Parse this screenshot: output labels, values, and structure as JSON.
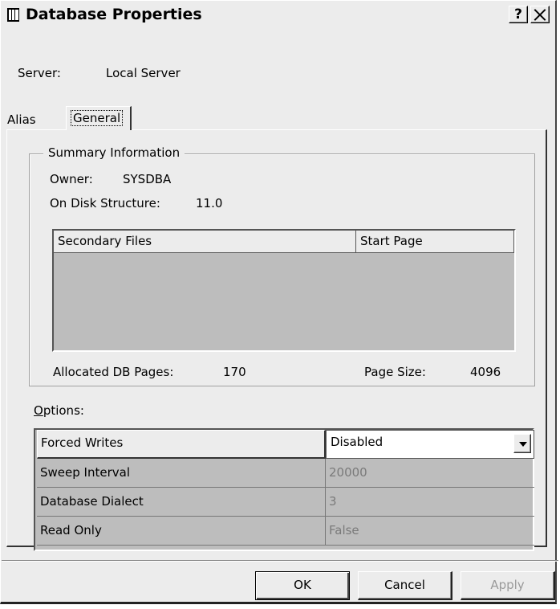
{
  "window": {
    "title": "Database Properties",
    "help_glyph": "?"
  },
  "server": {
    "label": "Server:",
    "value": "Local Server"
  },
  "tabs": [
    {
      "label": "Alias",
      "selected": false
    },
    {
      "label": "General",
      "selected": true
    }
  ],
  "summary": {
    "legend": "Summary Information",
    "owner_label": "Owner:",
    "owner_value": "SYSDBA",
    "ods_label": "On Disk Structure:",
    "ods_value": "11.0",
    "files_columns": [
      "Secondary Files",
      "Start Page"
    ],
    "files_rows": [],
    "allocated_label": "Allocated DB Pages:",
    "allocated_value": "170",
    "page_size_label": "Page Size:",
    "page_size_value": "4096"
  },
  "options": {
    "label": "Options:",
    "rows": [
      {
        "name": "Forced Writes",
        "value": "Disabled"
      },
      {
        "name": "Sweep Interval",
        "value": "20000"
      },
      {
        "name": "Database Dialect",
        "value": "3"
      },
      {
        "name": "Read Only",
        "value": "False"
      }
    ]
  },
  "buttons": {
    "ok": "OK",
    "cancel": "Cancel",
    "apply": "Apply"
  }
}
